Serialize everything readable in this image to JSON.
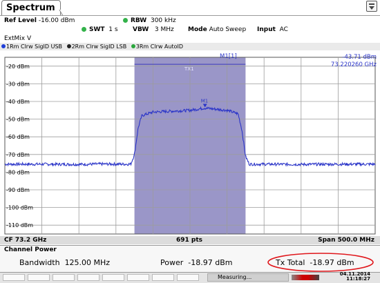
{
  "tab": {
    "label": "Spectrum"
  },
  "settings": {
    "ref_level_label": "Ref Level",
    "ref_level_value": "-16.00 dBm",
    "rbw_label": "RBW",
    "rbw_value": "300 kHz",
    "swt_label": "SWT",
    "swt_value": "1 s",
    "vbw_label": "VBW",
    "vbw_value": "3 MHz",
    "mode_label": "Mode",
    "mode_value": "Auto Sweep",
    "input_label": "Input",
    "input_value": "AC",
    "extmix": "ExtMix V"
  },
  "traces": [
    {
      "label": "1Rm Clrw SigID USB",
      "color": "#1f3fd8"
    },
    {
      "label": "2Rm Clrw SigID LSB",
      "color": "#222222"
    },
    {
      "label": "3Rm Clrw AutoID",
      "color": "#2aa63c"
    }
  ],
  "marker": {
    "label": "M1[1]",
    "level": "-43.71 dBm",
    "frequency": "73.220260 GHz",
    "plot_label": "M1"
  },
  "channel_label": "TX1",
  "chart_data": {
    "type": "line",
    "y_ticks": [
      "-20 dBm",
      "-30 dBm",
      "-40 dBm",
      "-50 dBm",
      "-60 dBm",
      "-70 dBm",
      "-80 dBm",
      "-90 dBm",
      "-100 dBm",
      "-110 dBm"
    ],
    "ylim": [
      -115,
      -15
    ],
    "xlim": [
      72.95,
      73.45
    ],
    "x_unit": "GHz",
    "series": [
      {
        "x": [
          72.95,
          73.0,
          73.05,
          73.08,
          73.12,
          73.125,
          73.13,
          73.135,
          73.15,
          73.2,
          73.22,
          73.25,
          73.265,
          73.27,
          73.275,
          73.28,
          73.3,
          73.35,
          73.4,
          73.45
        ],
        "y": [
          -75.5,
          -75.5,
          -75.6,
          -75.4,
          -75.5,
          -70.0,
          -55.0,
          -48.0,
          -46.0,
          -45.0,
          -43.7,
          -45.0,
          -47.0,
          -56.0,
          -71.0,
          -75.5,
          -75.5,
          -75.6,
          -75.5,
          -75.5
        ]
      }
    ],
    "channel_band": [
      73.125,
      73.275
    ],
    "grid": true
  },
  "footer": {
    "cf": "CF 73.2 GHz",
    "pts": "691 pts",
    "span": "Span 500.0 MHz"
  },
  "channel_power": {
    "title": "Channel Power",
    "bandwidth_label": "Bandwidth",
    "bandwidth_value": "125.00 MHz",
    "power_label": "Power",
    "power_value": "-18.97 dBm",
    "tx_total_label": "Tx Total",
    "tx_total_value": "-18.97 dBm"
  },
  "status": {
    "text": "Measuring...",
    "date": "04.11.2014",
    "time": "11:18:27"
  }
}
